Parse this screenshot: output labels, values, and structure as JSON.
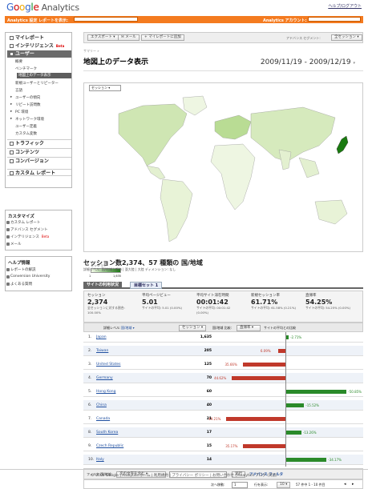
{
  "header": {
    "logo_word": "Google",
    "product": "Analytics",
    "help_link": "ヘルプ/ログアウト"
  },
  "orangebar": {
    "settings": "Analytics 設定",
    "view_reports": "レポートを表示:",
    "account_label": "Analytics アカウント:"
  },
  "sidebar": {
    "main_nav": [
      {
        "label": "マイレポート",
        "selected": false
      },
      {
        "label": "インテリジェンス",
        "badge": "Beta",
        "selected": false
      },
      {
        "label": "ユーザー",
        "selected": true
      }
    ],
    "user_items": [
      {
        "label": "概要"
      },
      {
        "label": "ベンチマーク"
      },
      {
        "label": "地図上のデータ表示",
        "selected": true
      },
      {
        "label": "新規ユーザーとリピーター"
      },
      {
        "label": "言語"
      },
      {
        "label": "ユーザーの傾向",
        "expand": true
      },
      {
        "label": "リピート訪問数",
        "expand": true
      },
      {
        "label": "PC 環境",
        "expand": true
      },
      {
        "label": "ネットワーク環境",
        "expand": true
      },
      {
        "label": "ユーザー定義"
      },
      {
        "label": "カスタム変数"
      }
    ],
    "lower_nav": [
      {
        "label": "トラフィック"
      },
      {
        "label": "コンテンツ"
      },
      {
        "label": "コンバージョン"
      }
    ],
    "custom_reports": "カスタム レポート",
    "customize": {
      "title": "カスタマイズ",
      "items": [
        "カスタム レポート",
        "アドバンス セグメント",
        "インテリジェンス",
        "メール"
      ],
      "beta": "Beta"
    },
    "help": {
      "title": "ヘルプ情報",
      "items": [
        "レポートの解説",
        "Conversion University",
        "よくある質問"
      ]
    }
  },
  "toolbar": {
    "export": "エクスポート",
    "email": "メール",
    "add_dashboard": "マイレポートに追加",
    "segment_label": "アドバンス セグメント:",
    "segment_value": "全セッション"
  },
  "breadcrumb": "サマリー »",
  "page_title": "地図上のデータ表示",
  "date_range": "2009/11/19 - 2009/12/19",
  "map": {
    "selector": "セッション",
    "legend_title": "セッション",
    "legend_min": "1",
    "legend_max": "1,635"
  },
  "summary_title": "セッション数2,374、57 種類の 国/地域",
  "detail_level": "詳細レベル: 国/地域 | 都市 | 亜大陸 | 大陸 ディメンション: なし",
  "tabs": [
    "サイトの利用状況",
    "目標セット 1"
  ],
  "metrics": [
    {
      "title": "セッション",
      "value": "2,374",
      "sub": "全セッションに対する割合: 100.00%"
    },
    {
      "title": "平均ページビュー",
      "value": "5.01",
      "sub": "サイトの平均: 5.01 (0.00%)"
    },
    {
      "title": "平均サイト滞在時間",
      "value": "00:01:42",
      "sub": "サイトの平均: 00:01:42 (0.00%)"
    },
    {
      "title": "新規セッション率",
      "value": "61.71%",
      "sub": "サイトの平均: 61.58% (0.21%)"
    },
    {
      "title": "直帰率",
      "value": "54.25%",
      "sub": "サイトの平均: 54.25% (0.00%)"
    }
  ],
  "table_controls": {
    "detail": "詳細レベル:",
    "dim": "国/地域",
    "metric_select": "セッション",
    "compare_label": "国/地域 比較:",
    "compare_value": "直帰率",
    "compare_text": "サイトの平均との比較"
  },
  "rows": [
    {
      "rank": "1.",
      "country": "Japan",
      "sessions": "1,635",
      "pct": "-2.71%",
      "delta": -2.71
    },
    {
      "rank": "2.",
      "country": "Taiwan",
      "sessions": "205",
      "pct": "6.09%",
      "delta": 6.09
    },
    {
      "rank": "3.",
      "country": "United States",
      "sessions": "125",
      "pct": "35.66%",
      "delta": 35.66
    },
    {
      "rank": "4.",
      "country": "Germany",
      "sessions": "70",
      "pct": "44.62%",
      "delta": 44.62
    },
    {
      "rank": "5.",
      "country": "Hong Kong",
      "sessions": "60",
      "pct": "-50.85%",
      "delta": -50.85
    },
    {
      "rank": "6.",
      "country": "China",
      "sessions": "40",
      "pct": "-15.52%",
      "delta": -15.52
    },
    {
      "rank": "7.",
      "country": "Canada",
      "sessions": "21",
      "pct": "49.21%",
      "delta": 49.21
    },
    {
      "rank": "8.",
      "country": "South Korea",
      "sessions": "17",
      "pct": "-13.26%",
      "delta": -13.26
    },
    {
      "rank": "9.",
      "country": "Czech Republic",
      "sessions": "15",
      "pct": "35.17%",
      "delta": 35.17
    },
    {
      "rank": "10.",
      "country": "Italy",
      "sessions": "14",
      "pct": "-34.17%",
      "delta": -34.17
    }
  ],
  "filter": {
    "label": "フィルタ 国/地域:",
    "select": "次の文字を含む",
    "go": "実行",
    "advanced": "アドバンス フィルタ"
  },
  "pager": {
    "show_label": "次へ移動:",
    "page_value": "1",
    "rows_label": "行を表示:",
    "rows_value": "10",
    "range": "57 件中 1 - 10 件目"
  },
  "footer": "© 2009 Google | Analytics ホーム | 利用規約 | プライバシー ポリシー | お問い合わせ | Analytics ブログ (英語)",
  "colors": {
    "orange": "#f47b20",
    "positive": "#2a8a2a",
    "negative": "#c0392b",
    "map_ocean": "#ffffff",
    "map_land": "#e7f2d3"
  }
}
